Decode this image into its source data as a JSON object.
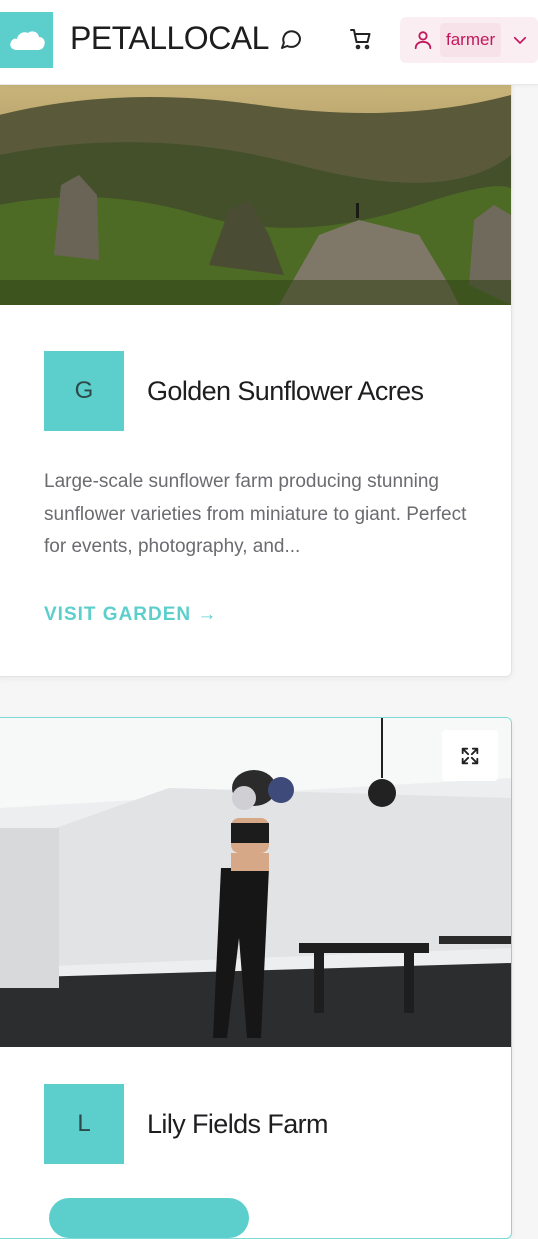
{
  "header": {
    "brand": "PETALLOCAL",
    "icons": [
      "cloud-logo-icon",
      "chat-icon",
      "cart-icon",
      "user-icon",
      "chevron-down-icon"
    ],
    "user": {
      "name": "farmer"
    }
  },
  "colors": {
    "accent": "#5ccfcc",
    "user_pill": "#fbeef3",
    "user_text": "#c2185b"
  },
  "gardens": [
    {
      "initial": "G",
      "name": "Golden Sunflower Acres",
      "description": "Large-scale sunflower farm producing stunning sunflower varieties from miniature to giant. Perfect for events, photography, and...",
      "link_label": "VISIT GARDEN →",
      "image_alt": "mountain landscape"
    },
    {
      "initial": "L",
      "name": "Lily Fields Farm",
      "image_alt": "woman boxing in gym",
      "expand_icon": "expand-icon"
    }
  ]
}
